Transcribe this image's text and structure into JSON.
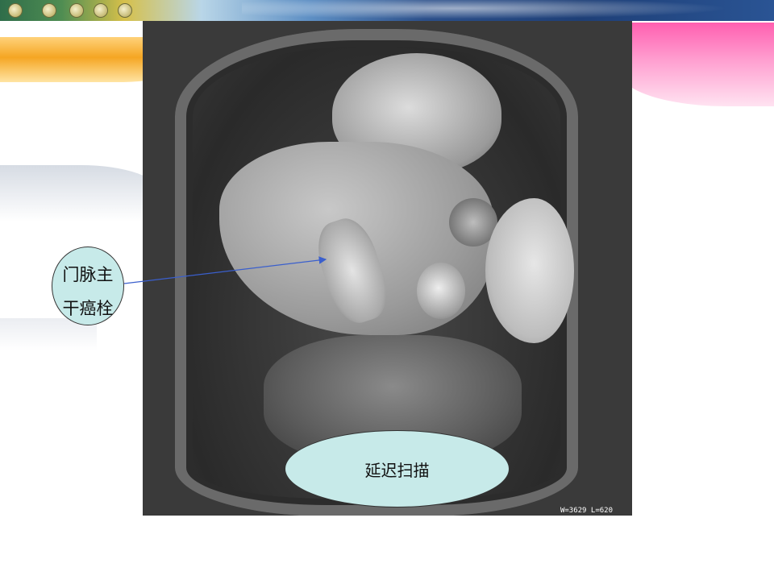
{
  "slide": {
    "callout_label": "门脉主干癌栓",
    "callout_line1": "门脉主",
    "callout_line2": "干癌栓",
    "scan_phase_label": "延迟扫描",
    "mri_window_info": "W=3629 L=620"
  },
  "colors": {
    "label_fill": "#c7eae9",
    "arrow": "#3a5fcd"
  }
}
